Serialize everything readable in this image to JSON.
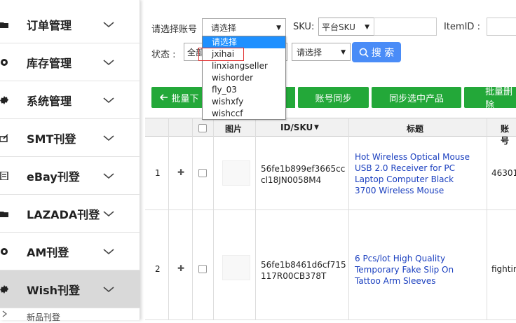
{
  "sidebar": {
    "items": [
      {
        "label": "订单管理",
        "icon": "folder-icon"
      },
      {
        "label": "库存管理",
        "icon": "gear-icon"
      },
      {
        "label": "系统管理",
        "icon": "cog-icon"
      },
      {
        "label": "SMT刊登",
        "icon": "pencil-icon"
      },
      {
        "label": "eBay刊登",
        "icon": "document-icon"
      },
      {
        "label": "LAZADA刊登",
        "icon": "folder-icon"
      },
      {
        "label": "AM刊登",
        "icon": "gear-icon"
      },
      {
        "label": "Wish刊登",
        "icon": "cog-icon"
      }
    ],
    "sub_item": "新品刊登"
  },
  "filters": {
    "account_label": "请选择账号",
    "account_value": "请选择",
    "sku_label": "SKU:",
    "sku_type": "平台SKU",
    "itemid_label": "ItemID :",
    "status_label": "状态 :",
    "status_value": "全部",
    "extra_select": "请选择",
    "search_label": "搜 索"
  },
  "dropdown": {
    "options": [
      "请选择",
      "jxihai",
      "linxiangseller",
      "wishorder",
      "fly_03",
      "wishxfy",
      "wishccf"
    ]
  },
  "actions": {
    "batch_download": "批量下",
    "account_sync": "账号同步",
    "sync_selected": "同步选中产品",
    "batch_delete": "批量删除"
  },
  "table": {
    "headers": {
      "image": "图片",
      "idsku": "ID/SKU",
      "title": "标题",
      "account": "账号"
    },
    "rows": [
      {
        "num": "1",
        "idsku": "56fe1b899ef3665cccl18JN0058M4",
        "title": "Hot Wireless Optical Mouse USB 2.0 Receiver for PC Laptop Computer Black 3700 Wireless Mouse",
        "account": "46301"
      },
      {
        "num": "2",
        "idsku": "56fe1b8461d6cf715117R00CB378T",
        "title": "6 Pcs/lot High Quality Temporary Fake Slip On Tattoo Arm Sleeves",
        "account": "fightin"
      }
    ]
  },
  "colors": {
    "green": "#23a839",
    "blue": "#4a8cf7",
    "link": "#1a3fbf",
    "highlight": "#e03131"
  }
}
